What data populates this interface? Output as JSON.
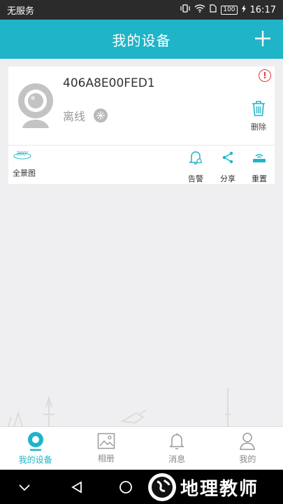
{
  "status_bar": {
    "carrier": "无服务",
    "battery": "100",
    "time": "16:17"
  },
  "header": {
    "title": "我的设备"
  },
  "device": {
    "id": "406A8E00FED1",
    "status": "离线",
    "delete_label": "删除",
    "actions": {
      "panorama_badge": "360°",
      "panorama_label": "全景图",
      "alarm_label": "告警",
      "share_label": "分享",
      "reset_label": "重置"
    }
  },
  "tabs": [
    {
      "label": "我的设备",
      "icon": "camera-icon",
      "active": true
    },
    {
      "label": "相册",
      "icon": "photo-icon",
      "active": false
    },
    {
      "label": "消息",
      "icon": "bell-icon",
      "active": false
    },
    {
      "label": "我的",
      "icon": "person-icon",
      "active": false
    }
  ],
  "watermark": {
    "text": "地理教师"
  },
  "colors": {
    "accent": "#1fb4c8",
    "alert": "#e03a3a"
  }
}
